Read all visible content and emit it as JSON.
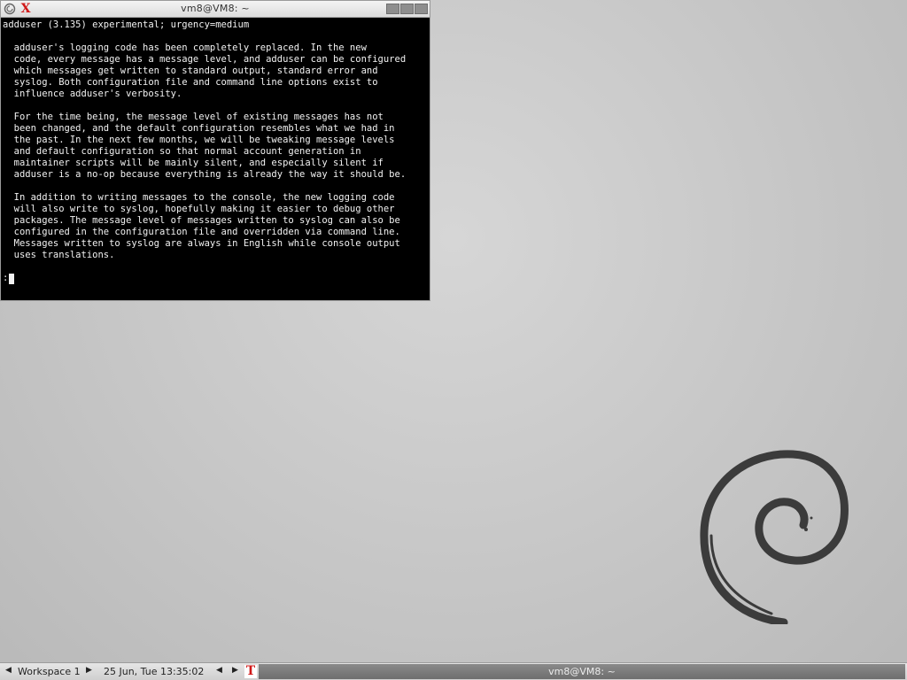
{
  "terminal": {
    "title": "vm8@VM8: ~",
    "lines": [
      "adduser (3.135) experimental; urgency=medium",
      "",
      "  adduser's logging code has been completely replaced. In the new",
      "  code, every message has a message level, and adduser can be configured",
      "  which messages get written to standard output, standard error and",
      "  syslog. Both configuration file and command line options exist to",
      "  influence adduser's verbosity.",
      "",
      "  For the time being, the message level of existing messages has not",
      "  been changed, and the default configuration resembles what we had in",
      "  the past. In the next few months, we will be tweaking message levels",
      "  and default configuration so that normal account generation in",
      "  maintainer scripts will be mainly silent, and especially silent if",
      "  adduser is a no-op because everything is already the way it should be.",
      "",
      "  In addition to writing messages to the console, the new logging code",
      "  will also write to syslog, hopefully making it easier to debug other",
      "  packages. The message level of messages written to syslog can also be",
      "  configured in the configuration file and overridden via command line.",
      "  Messages written to syslog are always in English while console output",
      "  uses translations.",
      ""
    ],
    "prompt": ":"
  },
  "taskbar": {
    "prev_arrow": "◀",
    "workspace": "Workspace 1",
    "next_arrow": "▶",
    "clock": "25 Jun, Tue 13:35:02",
    "nav_prev": "◀",
    "nav_next": "▶",
    "task_icon": "T",
    "task_title": "vm8@VM8: ~"
  },
  "icons": {
    "titlebar_app": "debian-swirl-icon",
    "titlebar_xterm": "xterm-x-icon",
    "task": "xterm-icon"
  },
  "colors": {
    "terminal_bg": "#000000",
    "terminal_fg": "#f2f2f2",
    "xterm_icon": "#d01818",
    "task_item_bg": "#7c7c7c",
    "desktop_bg": "#c9c9c9"
  }
}
